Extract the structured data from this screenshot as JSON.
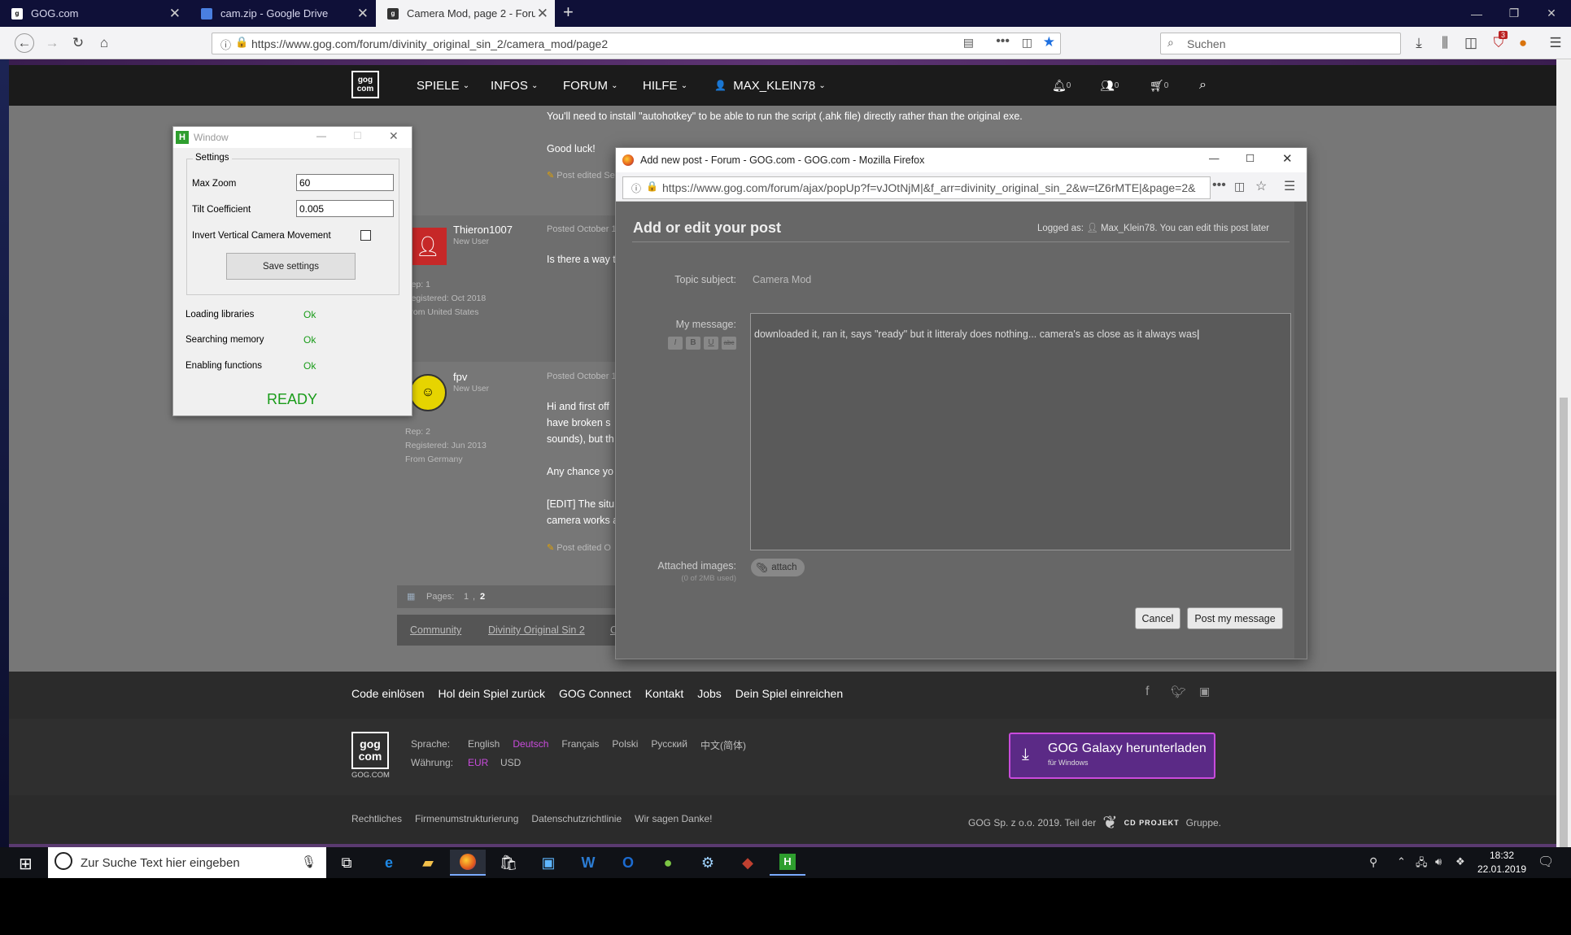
{
  "browser": {
    "tabs": [
      {
        "label": "GOG.com",
        "active": false
      },
      {
        "label": "cam.zip - Google Drive",
        "active": false
      },
      {
        "label": "Camera Mod, page 2 - Forum -",
        "active": true
      }
    ],
    "new_tab": "+",
    "url": "https://www.gog.com/forum/divinity_original_sin_2/camera_mod/page2",
    "search_placeholder": "Suchen",
    "badge_count": "3",
    "controls": {
      "minimize": "—",
      "restore": "❐",
      "close": "✕"
    }
  },
  "gog_header": {
    "logo_top": "gog",
    "logo_bottom": "com",
    "menu": [
      "SPIELE",
      "INFOS",
      "FORUM",
      "HILFE"
    ],
    "username": "MAX_KLEIN78",
    "notifications": "0",
    "friends": "0",
    "cart": "0"
  },
  "forum": {
    "post0_line1": "You'll need to install \"autohotkey\" to be able to run the script (.ahk file) directly rather than the original exe.",
    "post0_line2": "Good luck!",
    "post0_edited": "Post edited Se",
    "posts": [
      {
        "user": "Thieron1007",
        "role": "New User",
        "date": "Posted October 1",
        "text": "Is there a way t",
        "rep": "Rep: 1",
        "registered": "Registered: Oct 2018",
        "from": "From United States"
      },
      {
        "user": "fpv",
        "role": "New User",
        "date": "Posted October 1",
        "rep": "Rep: 2",
        "registered": "Registered: Jun 2013",
        "from": "From Germany",
        "lines": [
          "Hi and first off",
          "have broken s",
          "sounds), but th",
          "Any chance yo",
          "[EDIT] The situ",
          "camera works a"
        ],
        "edited": "Post edited O"
      }
    ],
    "pages_label": "Pages:",
    "page1": "1",
    "page_sep": ",",
    "page2": "2",
    "breadcrumb": [
      "Community",
      "Divinity Original Sin 2",
      "C"
    ]
  },
  "ahk_window": {
    "title": "Window",
    "group": "Settings",
    "max_zoom_label": "Max Zoom",
    "max_zoom_value": "60",
    "tilt_label": "Tilt Coefficient",
    "tilt_value": "0.005",
    "invert_label": "Invert Vertical Camera Movement",
    "invert_checked": false,
    "save_button": "Save settings",
    "status": [
      {
        "label": "Loading libraries",
        "value": "Ok"
      },
      {
        "label": "Searching memory",
        "value": "Ok"
      },
      {
        "label": "Enabling functions",
        "value": "Ok"
      }
    ],
    "ready": "READY"
  },
  "popup": {
    "window_title": "Add new post - Forum - GOG.com - GOG.com - Mozilla Firefox",
    "url": "https://www.gog.com/forum/ajax/popUp?f=vJOtNjM|&f_arr=divinity_original_sin_2&w=tZ6rMTE|&page=2&",
    "heading": "Add or edit your post",
    "logged_as_label": "Logged as:",
    "logged_as_user": "Max_Klein78",
    "logged_as_note": ". You can edit this post later",
    "topic_label": "Topic subject:",
    "topic_value": "Camera Mod",
    "message_label": "My message:",
    "format_buttons": [
      "I",
      "B",
      "U",
      "abc"
    ],
    "message_text": "downloaded it, ran it, says \"ready\" but it litteraly does nothing... camera's as close as it always was",
    "attached_label": "Attached images:",
    "attached_usage": "(0 of 2MB used)",
    "attach_button": "attach",
    "cancel_button": "Cancel",
    "post_button": "Post my message"
  },
  "footer": {
    "links": [
      "Code einlösen",
      "Hol dein Spiel zurück",
      "GOG Connect",
      "Kontakt",
      "Jobs",
      "Dein Spiel einreichen"
    ],
    "logo_caption": "GOG.COM",
    "language_label": "Sprache:",
    "languages": [
      "English",
      "Deutsch",
      "Français",
      "Polski",
      "Русский",
      "中文(简体)"
    ],
    "currency_label": "Währung:",
    "currencies": [
      "EUR",
      "USD"
    ],
    "galaxy_title": "GOG Galaxy herunterladen",
    "galaxy_sub": "für Windows",
    "legal": [
      "Rechtliches",
      "Firmenumstrukturierung",
      "Datenschutzrichtlinie",
      "Wir sagen Danke!"
    ],
    "company_prefix": "GOG Sp. z o.o. 2019. Teil der",
    "company_brand": "CD PROJEKT",
    "company_suffix": "Gruppe.",
    "accent_color": "#c94bdc",
    "galaxy_color": "#5b2a86"
  },
  "taskbar": {
    "search_placeholder": "Zur Suche Text hier eingeben",
    "time": "18:32",
    "date": "22.01.2019"
  }
}
